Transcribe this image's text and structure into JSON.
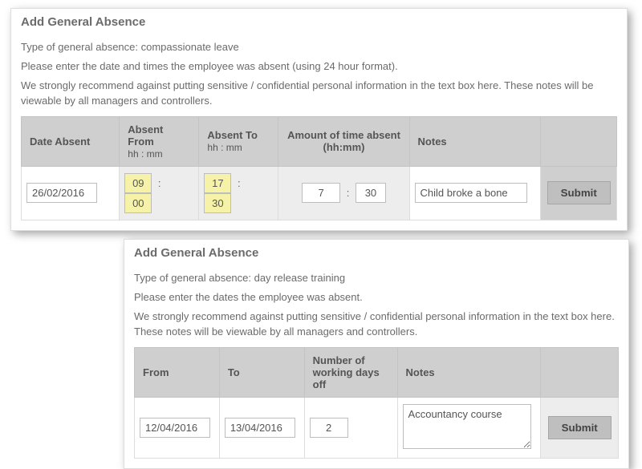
{
  "panel1": {
    "title": "Add General Absence",
    "type_line": "Type of general absence: compassionate leave",
    "instr": "Please enter the date and times the employee was absent (using 24 hour format).",
    "warn": "We strongly recommend against putting sensitive / confidential personal information in the text box here. These notes will be viewable by all managers and controllers.",
    "cols": {
      "date": "Date Absent",
      "from": "Absent From",
      "to": "Absent To",
      "hhmm": "hh   :   mm",
      "amount": "Amount of time absent (hh:mm)",
      "notes": "Notes"
    },
    "row": {
      "date": "26/02/2016",
      "from_hh": "09",
      "from_mm": "00",
      "to_hh": "17",
      "to_mm": "30",
      "amt_hh": "7",
      "amt_mm": "30",
      "notes": "Child broke a bone"
    },
    "submit": "Submit"
  },
  "panel2": {
    "title": "Add General Absence",
    "type_line": "Type of general absence: day release training",
    "instr": "Please enter the dates the employee was absent.",
    "warn": "We strongly recommend against putting sensitive / confidential personal information in the text box here. These notes will be viewable by all managers and controllers.",
    "cols": {
      "from": "From",
      "to": "To",
      "days": "Number of working days off",
      "notes": "Notes"
    },
    "row": {
      "from": "12/04/2016",
      "to": "13/04/2016",
      "days": "2",
      "notes": "Accountancy course"
    },
    "submit": "Submit"
  }
}
